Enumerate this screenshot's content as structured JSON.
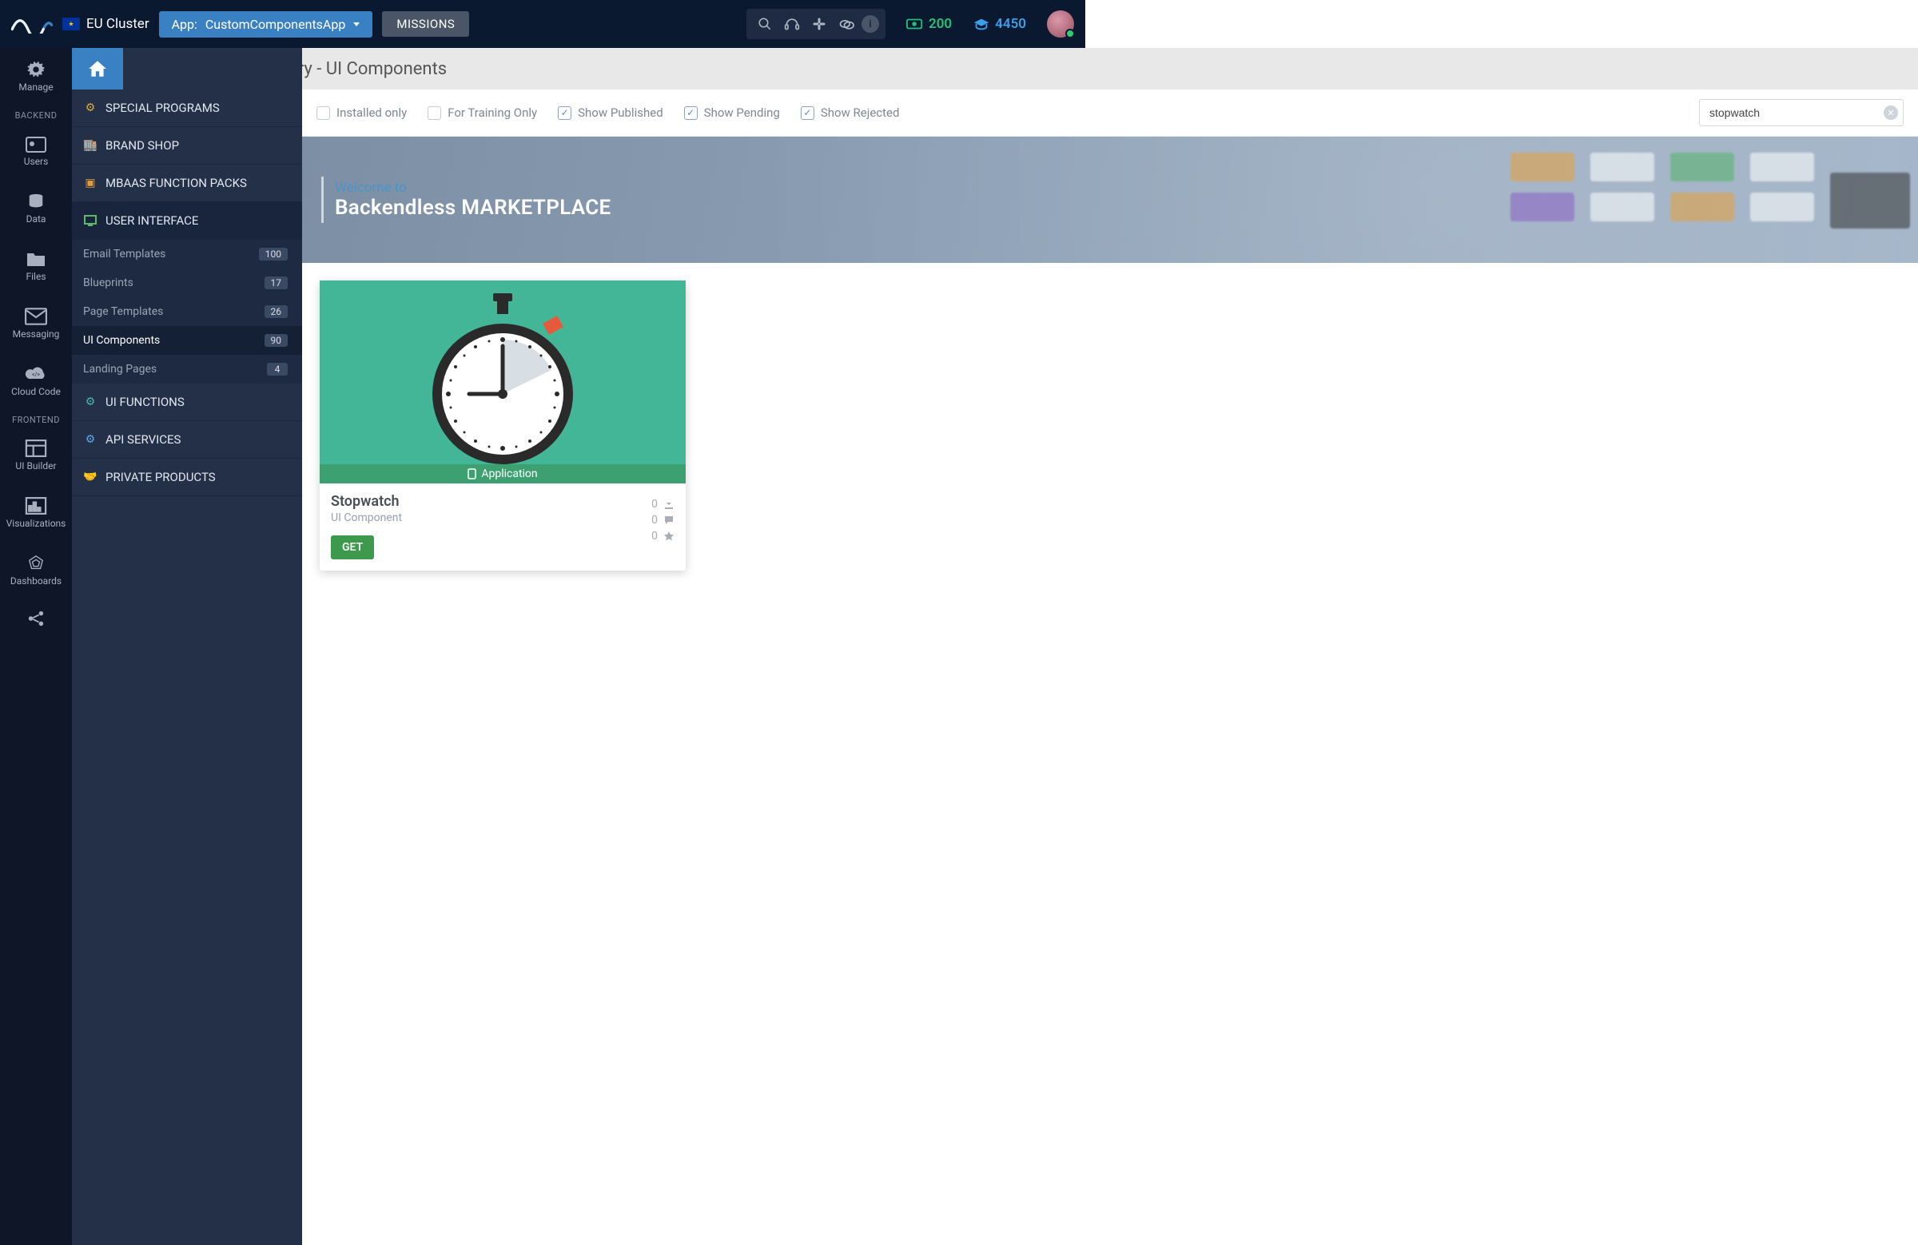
{
  "top": {
    "cluster": "EU Cluster",
    "app_prefix": "App: ",
    "app_name": "CustomComponentsApp",
    "missions": "MISSIONS",
    "credits": "200",
    "points": "4450"
  },
  "rail": {
    "manage": "Manage",
    "backend_header": "BACKEND",
    "users": "Users",
    "data": "Data",
    "files": "Files",
    "messaging": "Messaging",
    "cloud_code": "Cloud Code",
    "frontend_header": "FRONTEND",
    "ui_builder": "UI Builder",
    "visualizations": "Visualizations",
    "dashboards": "Dashboards"
  },
  "page_title": "Marketplace Category - UI Components",
  "categories": {
    "special": "SPECIAL PROGRAMS",
    "brand": "BRAND SHOP",
    "mbaas": "MBAAS FUNCTION PACKS",
    "ui": "USER INTERFACE",
    "ui_funcs": "UI FUNCTIONS",
    "api": "API SERVICES",
    "private": "PRIVATE PRODUCTS"
  },
  "ui_subs": [
    {
      "label": "Email Templates",
      "count": "100"
    },
    {
      "label": "Blueprints",
      "count": "17"
    },
    {
      "label": "Page Templates",
      "count": "26"
    },
    {
      "label": "UI Components",
      "count": "90"
    },
    {
      "label": "Landing Pages",
      "count": "4"
    }
  ],
  "filters": {
    "installed": "Installed only",
    "training": "For Training Only",
    "published": "Show Published",
    "pending": "Show Pending",
    "rejected": "Show Rejected"
  },
  "search": {
    "value": "stopwatch"
  },
  "banner": {
    "welcome": "Welcome to",
    "title": "Backendless MARKETPLACE"
  },
  "card": {
    "ribbon": "Application",
    "title": "Stopwatch",
    "subtitle": "UI Component",
    "get": "GET",
    "downloads": "0",
    "comments": "0",
    "stars": "0"
  }
}
